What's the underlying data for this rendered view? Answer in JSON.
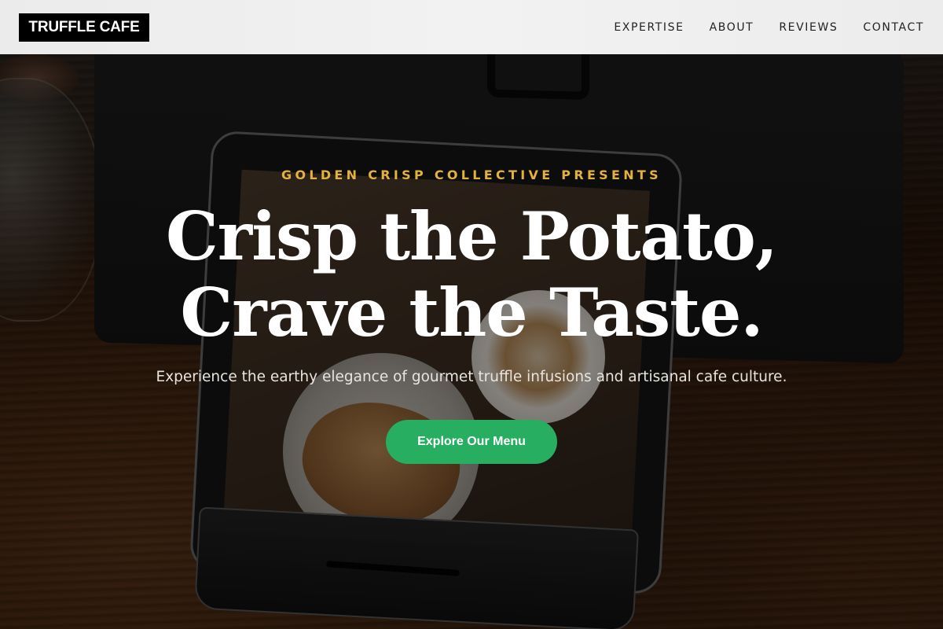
{
  "header": {
    "logo": "TRUFFLE CAFE",
    "nav": [
      "EXPERTISE",
      "ABOUT",
      "REVIEWS",
      "CONTACT"
    ]
  },
  "hero": {
    "eyebrow": "GOLDEN CRISP COLLECTIVE PRESENTS",
    "headline_line1": "Crisp the Potato,",
    "headline_line2": "Crave the Taste.",
    "subheading": "Experience the earthy elegance of gourmet truffle infusions and artisanal cafe culture.",
    "cta_label": "Explore Our Menu",
    "background_description": "",
    "colors": {
      "eyebrow": "#e3b23c",
      "cta": "#27ae60",
      "header_bg": "#efefef",
      "logo_bg": "#000000"
    }
  }
}
